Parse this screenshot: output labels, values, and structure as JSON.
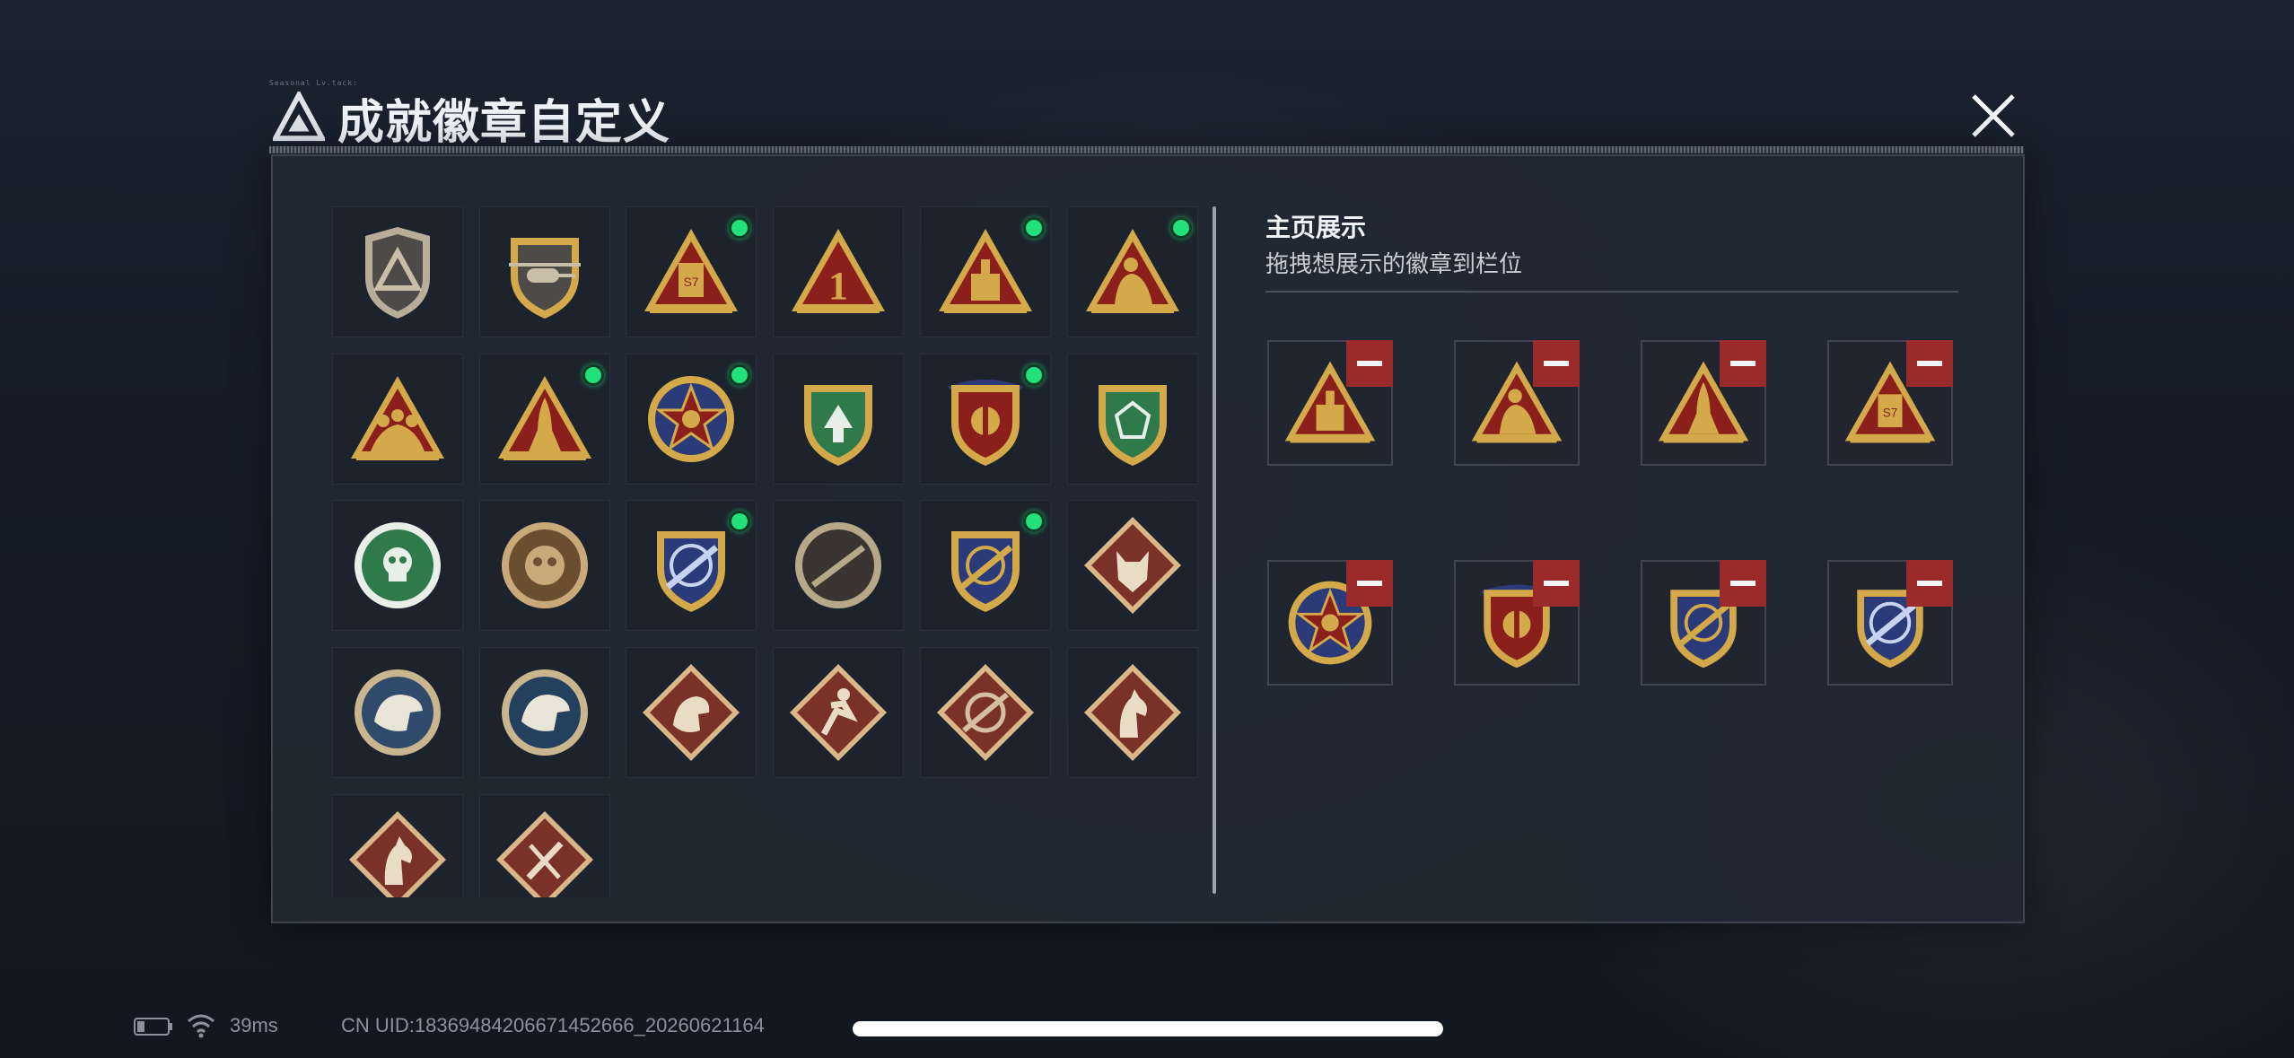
{
  "header": {
    "deco_text": "Seasonal Lv.tack:",
    "title": "成就徽章自定义"
  },
  "colors": {
    "gold": "#d3a94a",
    "red": "#8a1f1c",
    "green": "#2f7a4a",
    "navy": "#2b3a78",
    "equipped_dot": "#22e07a",
    "remove": "#9b2b2b"
  },
  "badges": [
    {
      "name": "badge-logo-shield",
      "icon": "logo-shield-icon",
      "equipped": false
    },
    {
      "name": "badge-helicopter",
      "icon": "helicopter-icon",
      "equipped": false
    },
    {
      "name": "badge-s7-triangle",
      "icon": "s7-triangle-icon",
      "equipped": true
    },
    {
      "name": "badge-number-one",
      "icon": "number-one-icon",
      "equipped": false
    },
    {
      "name": "badge-antenna-triangle",
      "icon": "antenna-triangle-icon",
      "equipped": true
    },
    {
      "name": "badge-soldier-triangle",
      "icon": "soldier-triangle-icon",
      "equipped": true
    },
    {
      "name": "badge-squad-triangle",
      "icon": "squad-triangle-icon",
      "equipped": false
    },
    {
      "name": "badge-rocket-triangle",
      "icon": "rocket-triangle-icon",
      "equipped": true
    },
    {
      "name": "badge-star-medal",
      "icon": "star-medal-icon",
      "equipped": true
    },
    {
      "name": "badge-green-shield-wing",
      "icon": "green-shield-icon",
      "equipped": false
    },
    {
      "name": "badge-gold-shield",
      "icon": "gold-shield-icon",
      "equipped": true
    },
    {
      "name": "badge-green-shield-gem",
      "icon": "green-gem-shield-icon",
      "equipped": false
    },
    {
      "name": "badge-green-skull",
      "icon": "green-skull-icon",
      "equipped": false
    },
    {
      "name": "badge-bronze-mask",
      "icon": "bronze-mask-icon",
      "equipped": false
    },
    {
      "name": "badge-navy-rifle",
      "icon": "navy-rifle-icon",
      "equipped": true
    },
    {
      "name": "badge-dark-rifle",
      "icon": "dark-rifle-icon",
      "equipped": false
    },
    {
      "name": "badge-gold-rifle",
      "icon": "gold-rifle-icon",
      "equipped": true
    },
    {
      "name": "badge-wolf-diamond",
      "icon": "wolf-diamond-icon",
      "equipped": false
    },
    {
      "name": "badge-eagle-blue",
      "icon": "eagle-icon",
      "equipped": false
    },
    {
      "name": "badge-eagle-navy",
      "icon": "eagle-target-icon",
      "equipped": false
    },
    {
      "name": "badge-dragon-diamond",
      "icon": "dragon-diamond-icon",
      "equipped": false
    },
    {
      "name": "badge-runner-diamond",
      "icon": "runner-diamond-icon",
      "equipped": false
    },
    {
      "name": "badge-target-diamond",
      "icon": "target-diamond-icon",
      "equipped": false
    },
    {
      "name": "badge-horse-diamond",
      "icon": "horse-diamond-icon",
      "equipped": false
    },
    {
      "name": "badge-horse-diamond-2",
      "icon": "horse-diamond-icon",
      "equipped": false
    },
    {
      "name": "badge-tools-diamond",
      "icon": "tools-diamond-icon",
      "equipped": false
    }
  ],
  "display": {
    "title": "主页展示",
    "subtitle": "拖拽想展示的徽章到栏位",
    "slots": [
      {
        "icon": "antenna-triangle-icon"
      },
      {
        "icon": "soldier-triangle-icon"
      },
      {
        "icon": "rocket-triangle-icon"
      },
      {
        "icon": "s7-triangle-icon"
      },
      {
        "icon": "star-medal-icon"
      },
      {
        "icon": "gold-shield-icon"
      },
      {
        "icon": "gold-rifle-icon"
      },
      {
        "icon": "navy-rifle-icon"
      }
    ]
  },
  "status_bar": {
    "ping": "39ms",
    "uid": "CN UID:183694842066714526​66_2026062116​4"
  }
}
